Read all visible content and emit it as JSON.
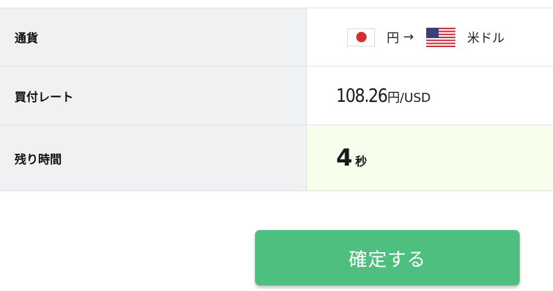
{
  "table": {
    "currency": {
      "label": "通貨",
      "from": "円",
      "arrow": "→",
      "to": "米ドル",
      "from_flag_icon": "japan-flag-icon",
      "to_flag_icon": "us-flag-icon"
    },
    "rate": {
      "label": "買付レート",
      "value": "108.26",
      "unit": "円/USD"
    },
    "remaining": {
      "label": "残り時間",
      "value": "4",
      "unit": "秒"
    }
  },
  "confirm_button": {
    "label": "確定する"
  },
  "colors": {
    "label_bg": "#f0f1f3",
    "highlight_bg": "#f6ffec",
    "button": "#4fbf80",
    "jp_red": "#d0312d",
    "us_red": "#c8313a",
    "us_blue": "#3a3f7a"
  }
}
